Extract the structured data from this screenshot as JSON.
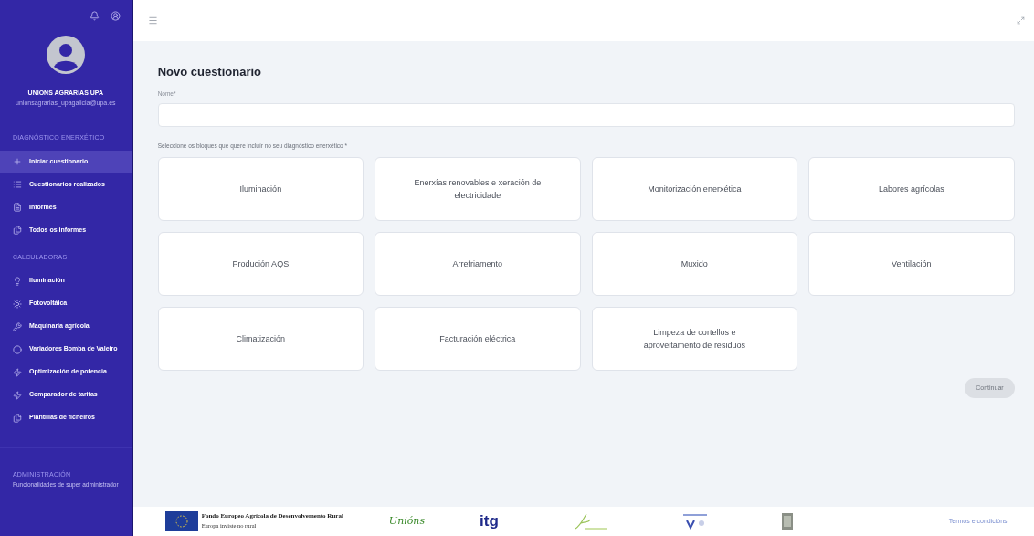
{
  "user": {
    "name": "UNIONS AGRARIAS UPA",
    "email": "unionsagrarias_upagalicia@upa.es"
  },
  "sidebar": {
    "sections": [
      {
        "title": "DIAGNÓSTICO ENERXÉTICO",
        "items": [
          {
            "label": "Iniciar cuestionario",
            "selected": true
          },
          {
            "label": "Cuestionarios realizados",
            "selected": false
          },
          {
            "label": "Informes",
            "selected": false
          },
          {
            "label": "Todos os informes",
            "selected": false
          }
        ]
      },
      {
        "title": "CALCULADORAS",
        "items": [
          {
            "label": "Iluminación",
            "selected": false
          },
          {
            "label": "Fotovoltáica",
            "selected": false
          },
          {
            "label": "Maquinaria agrícola",
            "selected": false
          },
          {
            "label": "Variadores Bomba de Valeiro",
            "selected": false
          },
          {
            "label": "Optimización de potencia",
            "selected": false
          },
          {
            "label": "Comparador de tarifas",
            "selected": false
          },
          {
            "label": "Plantillas de ficheiros",
            "selected": false
          }
        ]
      }
    ],
    "admin": {
      "title": "ADMINISTRACIÓN",
      "subtitle": "Funcionalidades de super administrador"
    }
  },
  "page": {
    "title": "Novo cuestionario",
    "name_label": "Nome*",
    "blocks_label": "Seleccione os bloques que quere incluír no seu diagnóstico enerxético *",
    "blocks": [
      {
        "label": "Iluminación",
        "selected": false
      },
      {
        "label": "Enerxías renovables e xeración de electricidade",
        "selected": false
      },
      {
        "label": "Monitorización enerxética",
        "selected": false
      },
      {
        "label": "Labores agrícolas",
        "selected": false
      },
      {
        "label": "Produción AQS",
        "selected": false
      },
      {
        "label": "Arrefriamento",
        "selected": false
      },
      {
        "label": "Muxido",
        "selected": false
      },
      {
        "label": "Ventilación",
        "selected": false
      },
      {
        "label": "Climatización",
        "selected": false
      },
      {
        "label": "Facturación eléctrica",
        "selected": false
      },
      {
        "label": "Limpeza de cortellos e aproveitamento de residuos",
        "selected": false
      }
    ],
    "continue": {
      "label": "Continuar",
      "disabled": true
    }
  },
  "footer": {
    "feader": "Fondo Europeo Agrícola de Desenvolvemento Rural",
    "feader_sub": "Europa inviste no rural",
    "unions": "Unións",
    "itg": "itg",
    "terms": "Termos e condicións"
  }
}
